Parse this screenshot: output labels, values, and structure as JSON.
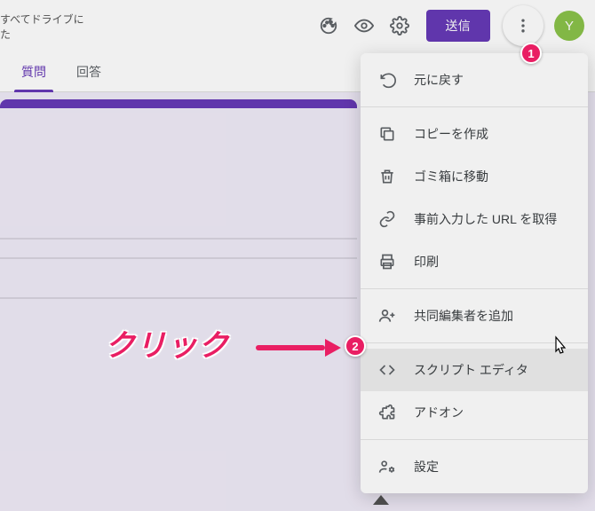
{
  "header": {
    "drive_status": "すべてドライブに\nた",
    "send_label": "送信",
    "avatar_letter": "Y"
  },
  "tabs": {
    "questions": "質問",
    "responses": "回答"
  },
  "menu": {
    "undo": "元に戻す",
    "copy": "コピーを作成",
    "trash": "ゴミ箱に移動",
    "prefill": "事前入力した URL を取得",
    "print": "印刷",
    "collab": "共同編集者を追加",
    "script": "スクリプト エディタ",
    "addons": "アドオン",
    "settings": "設定"
  },
  "annotations": {
    "badge1": "1",
    "badge2": "2",
    "click_text": "クリック"
  }
}
